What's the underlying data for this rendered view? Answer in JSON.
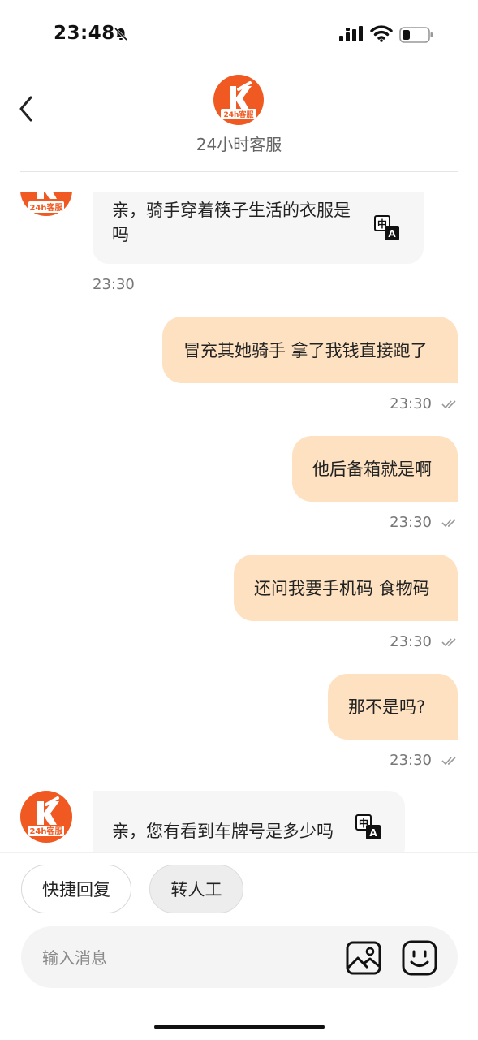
{
  "status_bar": {
    "time": "23:48"
  },
  "header": {
    "title": "24小时客服",
    "logo_text": "24h客服"
  },
  "messages": [
    {
      "from": "agent",
      "text_line1": "亲，骑手穿着筷子生活的衣服是",
      "text_line2": "吗",
      "time": "23:30"
    },
    {
      "from": "user",
      "text": "冒充其她骑手 拿了我钱直接跑了",
      "time": "23:30"
    },
    {
      "from": "user",
      "text": "他后备箱就是啊",
      "time": "23:30"
    },
    {
      "from": "user",
      "text": "还问我要手机码 食物码",
      "time": "23:30"
    },
    {
      "from": "user",
      "text": "那不是吗?",
      "time": "23:30"
    },
    {
      "from": "agent",
      "text": "亲，您有看到车牌号是多少吗"
    }
  ],
  "quick_actions": {
    "quick_reply": "快捷回复",
    "transfer_agent": "转人工"
  },
  "composer": {
    "placeholder": "输入消息"
  },
  "icons": {
    "translate": "translate-icon",
    "image": "image-icon",
    "emoji": "emoji-icon",
    "back": "back-arrow-icon",
    "read_receipt": "double-check-icon"
  },
  "colors": {
    "brand": "#f05a22",
    "outgoing_bubble": "#fde1c0",
    "incoming_bubble": "#f6f6f6"
  }
}
